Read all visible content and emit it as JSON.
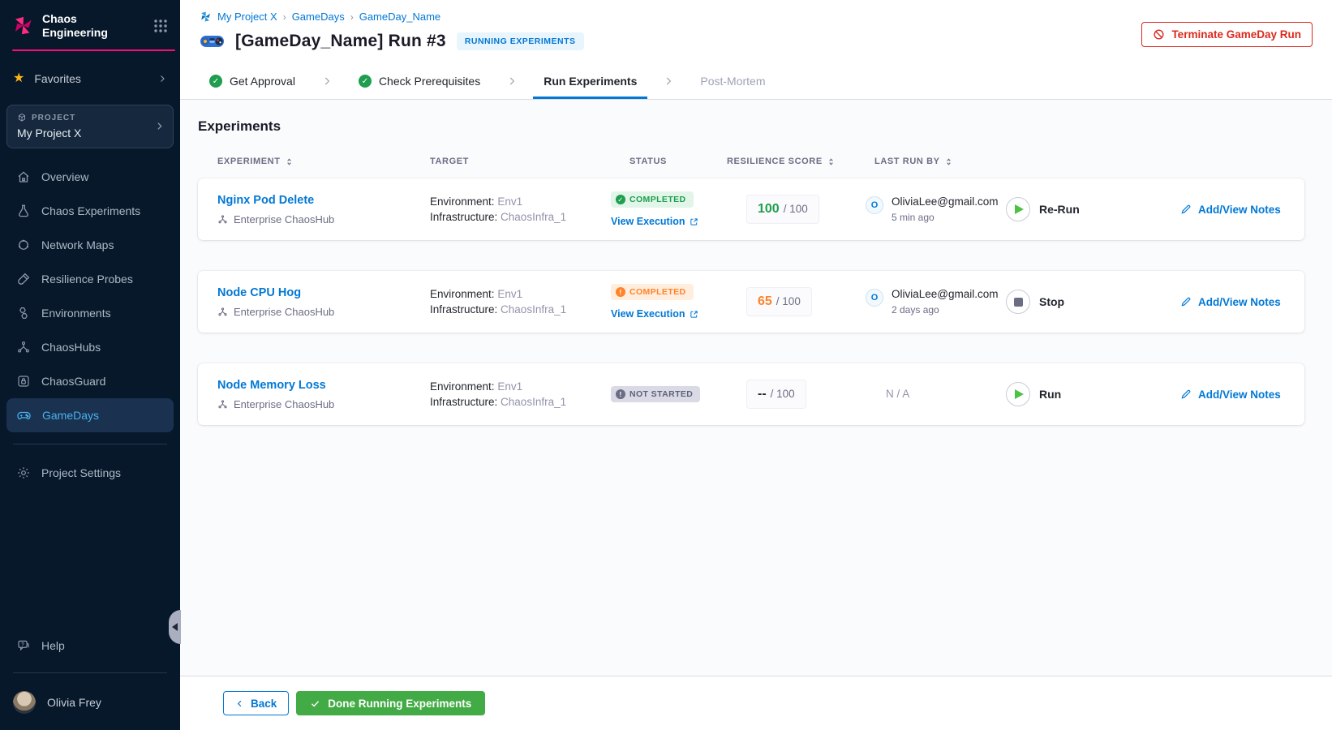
{
  "sidebar": {
    "title": "Chaos Engineering",
    "favorites": "Favorites",
    "project_label": "PROJECT",
    "project_name": "My Project X",
    "nav": [
      {
        "label": "Overview"
      },
      {
        "label": "Chaos Experiments"
      },
      {
        "label": "Network Maps"
      },
      {
        "label": "Resilience Probes"
      },
      {
        "label": "Environments"
      },
      {
        "label": "ChaosHubs"
      },
      {
        "label": "ChaosGuard"
      },
      {
        "label": "GameDays",
        "active": true
      }
    ],
    "project_settings": "Project Settings",
    "help": "Help",
    "user": "Olivia Frey"
  },
  "header": {
    "breadcrumb": {
      "project": "My Project X",
      "section": "GameDays",
      "page": "GameDay_Name"
    },
    "title": "[GameDay_Name] Run #3",
    "badge": "RUNNING EXPERIMENTS",
    "terminate": "Terminate GameDay Run"
  },
  "stepper": {
    "step1": "Get Approval",
    "step2": "Check Prerequisites",
    "step3": "Run Experiments",
    "step4": "Post-Mortem"
  },
  "experiments": {
    "section_title": "Experiments",
    "columns": {
      "experiment": "EXPERIMENT",
      "target": "TARGET",
      "status": "STATUS",
      "score": "RESILIENCE SCORE",
      "last_run": "LAST RUN BY"
    },
    "labels": {
      "environment": "Environment:",
      "infrastructure": "Infrastructure:",
      "view_execution": "View Execution",
      "notes": "Add/View Notes"
    },
    "rows": [
      {
        "name": "Nginx Pod Delete",
        "hub": "Enterprise ChaosHub",
        "environment": "Env1",
        "infrastructure": "ChaosInfra_1",
        "status": "COMPLETED",
        "score": "100",
        "score_max": "/ 100",
        "avatar": "O",
        "run_by": "OliviaLee@gmail.com",
        "run_time": "5 min ago",
        "action": "Re-Run"
      },
      {
        "name": "Node CPU Hog",
        "hub": "Enterprise ChaosHub",
        "environment": "Env1",
        "infrastructure": "ChaosInfra_1",
        "status": "COMPLETED",
        "score": "65",
        "score_max": "/ 100",
        "avatar": "O",
        "run_by": "OliviaLee@gmail.com",
        "run_time": "2 days ago",
        "action": "Stop"
      },
      {
        "name": "Node Memory Loss",
        "hub": "Enterprise ChaosHub",
        "environment": "Env1",
        "infrastructure": "ChaosInfra_1",
        "status": "NOT STARTED",
        "score": "--",
        "score_max": "/ 100",
        "last_run_na": "N / A",
        "action": "Run"
      }
    ]
  },
  "footer": {
    "back": "Back",
    "done": "Done Running Experiments"
  },
  "colors": {
    "accent_blue": "#0278d5",
    "brand_magenta": "#ff0a78",
    "success_green": "#1e9e4e",
    "warning_orange": "#ff832b",
    "danger_red": "#da291e",
    "done_button_green": "#42ab45",
    "play_green": "#4cc143",
    "sidebar_bg": "#07182b",
    "nav_active_blue": "#47b1ec",
    "favorites_star_yellow": "#fcb519"
  }
}
